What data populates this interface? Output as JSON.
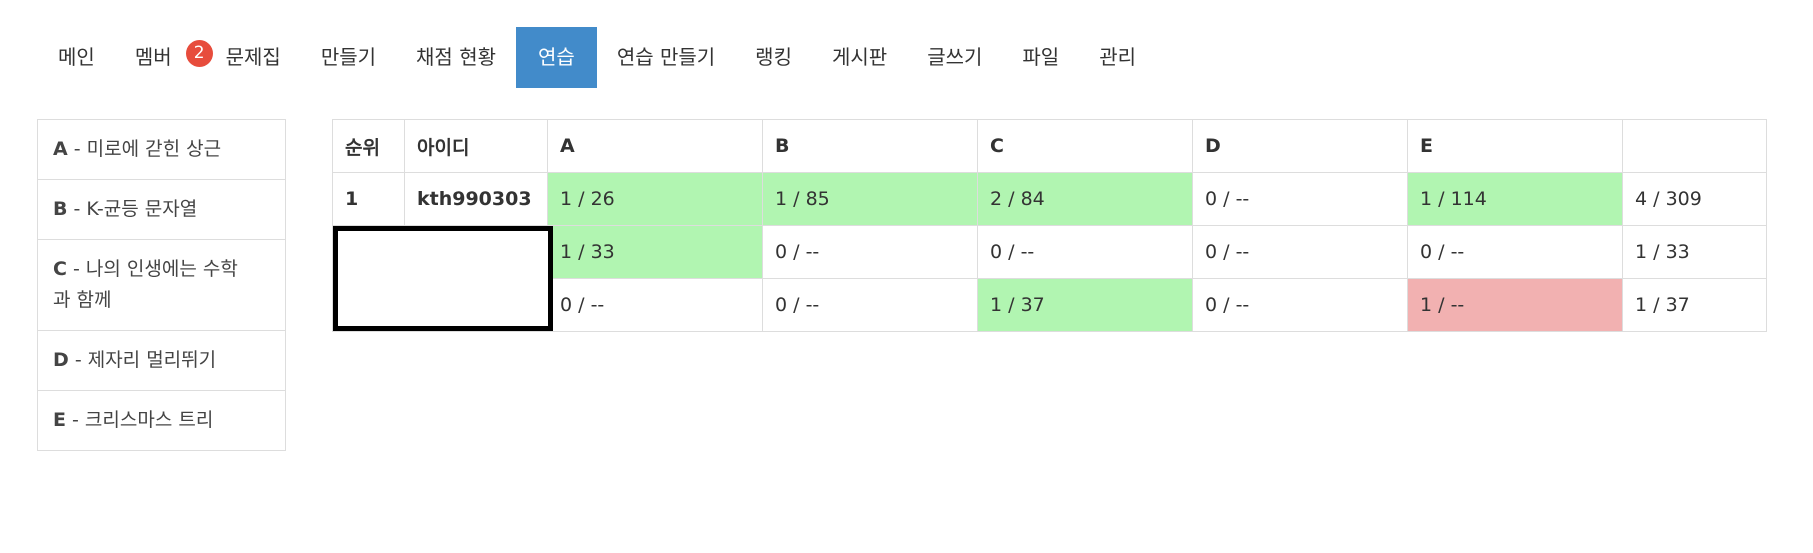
{
  "nav": {
    "items": [
      {
        "label": "메인"
      },
      {
        "label": "멤버",
        "badge": "2"
      },
      {
        "label": "문제집"
      },
      {
        "label": "만들기"
      },
      {
        "label": "채점 현황"
      },
      {
        "label": "연습",
        "active": true
      },
      {
        "label": "연습 만들기"
      },
      {
        "label": "랭킹"
      },
      {
        "label": "게시판"
      },
      {
        "label": "글쓰기"
      },
      {
        "label": "파일"
      },
      {
        "label": "관리"
      }
    ]
  },
  "problems": [
    {
      "letter": "A",
      "title": " - 미로에 갇힌 상근"
    },
    {
      "letter": "B",
      "title": " - K-균등 문자열"
    },
    {
      "letter": "C",
      "title": " - 나의 인생에는 수학",
      "title2": "과 함께"
    },
    {
      "letter": "D",
      "title": " - 제자리 멀리뛰기"
    },
    {
      "letter": "E",
      "title": " - 크리스마스 트리"
    }
  ],
  "scoreboard": {
    "headers": [
      "순위",
      "아이디",
      "A",
      "B",
      "C",
      "D",
      "E",
      ""
    ],
    "rows": [
      {
        "rank": "1",
        "id": "kth990303",
        "cells": [
          "1 / 26",
          "1 / 85",
          "2 / 84",
          "0 / --",
          "1 / 114"
        ],
        "total": "4 / 309"
      },
      {
        "rank": "",
        "id": "",
        "cells": [
          "1 / 33",
          "0 / --",
          "0 / --",
          "0 / --",
          "0 / --"
        ],
        "total": "1 / 33"
      },
      {
        "rank": "",
        "id": "",
        "cells": [
          "0 / --",
          "0 / --",
          "1 / 37",
          "0 / --",
          "1 / --"
        ],
        "total": "1 / 37"
      }
    ]
  },
  "colors": {
    "active_tab": "#428bca",
    "badge": "#e74c3c",
    "solved": "#b1f5b1",
    "wrong": "#f2b1b1"
  }
}
